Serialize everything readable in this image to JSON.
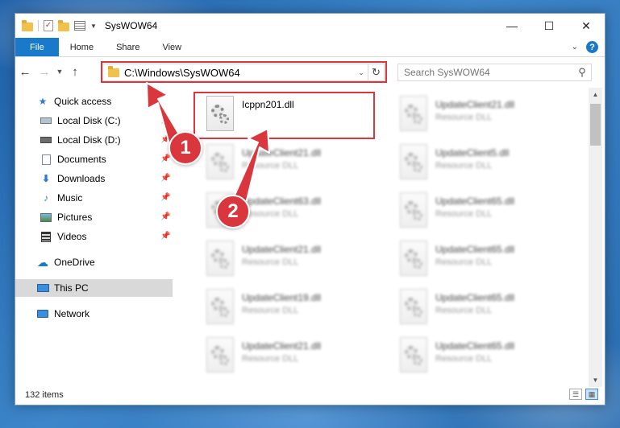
{
  "window": {
    "title": "SysWOW64",
    "controls": {
      "minimize": "—",
      "maximize": "☐",
      "close": "✕"
    }
  },
  "ribbon": {
    "tabs": [
      {
        "label": "File",
        "active": true
      },
      {
        "label": "Home"
      },
      {
        "label": "Share"
      },
      {
        "label": "View"
      }
    ],
    "help": "?"
  },
  "address": {
    "path": "C:\\Windows\\SysWOW64"
  },
  "search": {
    "placeholder": "Search SysWOW64"
  },
  "sidebar": {
    "items": [
      {
        "label": "Quick access",
        "icon": "star-icon"
      },
      {
        "label": "Local Disk (C:)",
        "icon": "drive-icon",
        "pinned": true
      },
      {
        "label": "Local Disk (D:)",
        "icon": "drive-icon",
        "pinned": true
      },
      {
        "label": "Documents",
        "icon": "documents-icon",
        "pinned": true
      },
      {
        "label": "Downloads",
        "icon": "downloads-icon",
        "pinned": true
      },
      {
        "label": "Music",
        "icon": "music-icon",
        "pinned": true
      },
      {
        "label": "Pictures",
        "icon": "pictures-icon",
        "pinned": true
      },
      {
        "label": "Videos",
        "icon": "videos-icon",
        "pinned": true
      },
      {
        "label": "OneDrive",
        "icon": "cloud-icon"
      },
      {
        "label": "This PC",
        "icon": "computer-icon",
        "selected": true
      },
      {
        "label": "Network",
        "icon": "network-icon"
      }
    ]
  },
  "files": [
    {
      "name": "Icppn201.dll",
      "type": "",
      "highlighted": true
    },
    {
      "name": "UpdateClient21.dll",
      "type": "Resource DLL"
    },
    {
      "name": "UpdateClient21.dll",
      "type": "Resource DLL"
    },
    {
      "name": "UpdateClient5.dll",
      "type": "Resource DLL"
    },
    {
      "name": "UpdateClient63.dll",
      "type": "Resource DLL"
    },
    {
      "name": "UpdateClient65.dll",
      "type": "Resource DLL"
    },
    {
      "name": "UpdateClient21.dll",
      "type": "Resource DLL"
    },
    {
      "name": "UpdateClient65.dll",
      "type": "Resource DLL"
    },
    {
      "name": "UpdateClient19.dll",
      "type": "Resource DLL"
    },
    {
      "name": "UpdateClient65.dll",
      "type": "Resource DLL"
    },
    {
      "name": "UpdateClient21.dll",
      "type": "Resource DLL"
    },
    {
      "name": "UpdateClient65.dll",
      "type": "Resource DLL"
    }
  ],
  "status": {
    "item_count": "132 items"
  },
  "annotations": {
    "step1": "1",
    "step2": "2",
    "color": "#d9363e"
  }
}
